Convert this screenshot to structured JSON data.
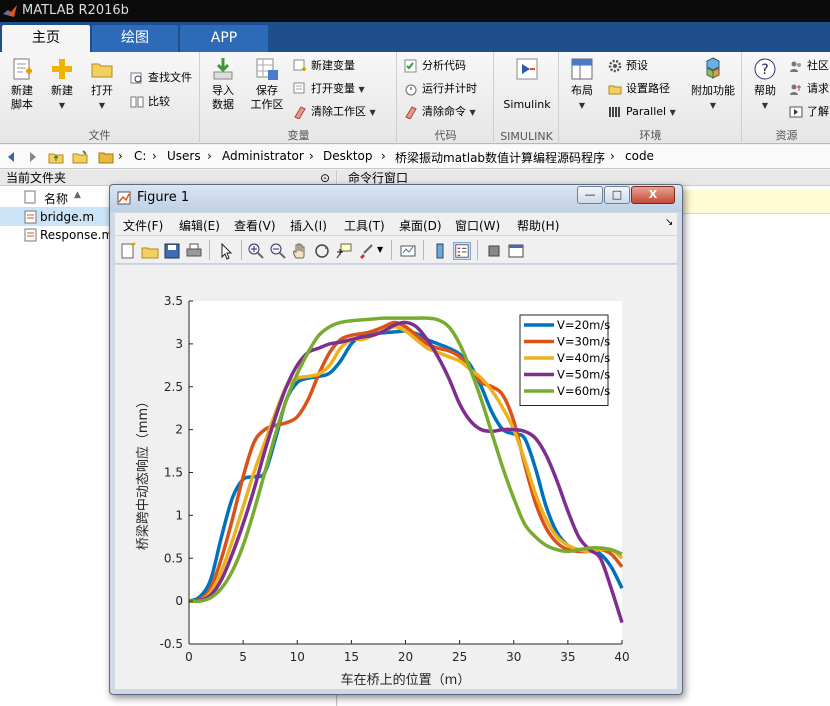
{
  "app": {
    "title": "MATLAB R2016b"
  },
  "ribbon_tabs": [
    {
      "label": "主页",
      "active": true
    },
    {
      "label": "绘图",
      "active": false
    },
    {
      "label": "APP",
      "active": false
    }
  ],
  "groups": {
    "file": {
      "label": "文件",
      "new_script": [
        "新建",
        "脚本"
      ],
      "new": "新建",
      "open": "打开",
      "find_files": "查找文件",
      "compare": "比较"
    },
    "variable": {
      "label": "变量",
      "import": [
        "导入",
        "数据"
      ],
      "save_ws": [
        "保存",
        "工作区"
      ],
      "new_var": "新建变量",
      "open_var": "打开变量",
      "clear_ws": "清除工作区"
    },
    "code": {
      "label": "代码",
      "analyze": "分析代码",
      "run_time": "运行并计时",
      "clear_cmd": "清除命令"
    },
    "simulink": {
      "label": "SIMULINK",
      "btn": "Simulink"
    },
    "env": {
      "label": "环境",
      "layout": "布局",
      "prefs": "预设",
      "set_path": "设置路径",
      "parallel": "Parallel",
      "addons": "附加功能"
    },
    "resources": {
      "label": "资源",
      "help": "帮助",
      "community": "社区",
      "request": "请求",
      "learn": "了解"
    }
  },
  "address": {
    "crumbs": [
      "C:",
      "Users",
      "Administrator",
      "Desktop",
      "桥梁振动matlab数值计算编程源码程序",
      "code"
    ]
  },
  "file_panel": {
    "title": "当前文件夹",
    "col_name": "名称",
    "files": [
      {
        "name": "bridge.m",
        "selected": true
      },
      {
        "name": "Response.m",
        "selected": false
      }
    ]
  },
  "cmd_panel": {
    "title": "命令行窗口"
  },
  "figure": {
    "title": "Figure 1",
    "menu": [
      "文件(F)",
      "编辑(E)",
      "查看(V)",
      "插入(I)",
      "工具(T)",
      "桌面(D)",
      "窗口(W)",
      "帮助(H)"
    ],
    "window_buttons": {
      "min": "—",
      "max": "□",
      "close": "X"
    }
  },
  "chart_data": {
    "type": "line",
    "title": "",
    "xlabel": "车在桥上的位置（m）",
    "ylabel": "桥梁跨中动态响应（mm）",
    "xlim": [
      0,
      40
    ],
    "ylim": [
      -0.5,
      3.5
    ],
    "xticks": [
      0,
      5,
      10,
      15,
      20,
      25,
      30,
      35,
      40
    ],
    "yticks": [
      -0.5,
      0,
      0.5,
      1,
      1.5,
      2,
      2.5,
      3,
      3.5
    ],
    "grid": false,
    "legend_position": "top-right",
    "colors": {
      "axes_bg": "#ffffff",
      "canvas_bg": "#f0f0f0"
    },
    "series": [
      {
        "name": "V=20m/s",
        "color": "#0072bd",
        "x": [
          0,
          1,
          2,
          3,
          4,
          5,
          6,
          7,
          8,
          9,
          10,
          11,
          12,
          13,
          14,
          15,
          16,
          17,
          18,
          19,
          20,
          21,
          22,
          23,
          24,
          25,
          26,
          27,
          28,
          29,
          30,
          31,
          32,
          33,
          34,
          35,
          36,
          37,
          38,
          39,
          40
        ],
        "y": [
          0,
          0.05,
          0.25,
          0.75,
          1.2,
          1.42,
          1.45,
          1.5,
          1.9,
          2.35,
          2.55,
          2.6,
          2.62,
          2.66,
          2.8,
          3.0,
          3.1,
          3.12,
          3.13,
          3.14,
          3.15,
          3.12,
          3.05,
          3.0,
          2.95,
          2.88,
          2.75,
          2.5,
          2.2,
          2.0,
          1.95,
          1.9,
          1.55,
          1.1,
          0.8,
          0.65,
          0.6,
          0.6,
          0.55,
          0.4,
          0.15
        ]
      },
      {
        "name": "V=30m/s",
        "color": "#d95319",
        "x": [
          0,
          1,
          2,
          3,
          4,
          5,
          6,
          7,
          8,
          9,
          10,
          11,
          12,
          13,
          14,
          15,
          16,
          17,
          18,
          19,
          20,
          21,
          22,
          23,
          24,
          25,
          26,
          27,
          28,
          29,
          30,
          31,
          32,
          33,
          34,
          35,
          36,
          37,
          38,
          39,
          40
        ],
        "y": [
          0,
          0.02,
          0.15,
          0.5,
          0.95,
          1.45,
          1.85,
          2.0,
          2.05,
          2.08,
          2.15,
          2.35,
          2.65,
          2.9,
          3.05,
          3.1,
          3.12,
          3.15,
          3.2,
          3.25,
          3.2,
          3.1,
          3.0,
          2.95,
          2.92,
          2.85,
          2.7,
          2.55,
          2.5,
          2.4,
          2.1,
          1.6,
          1.15,
          0.85,
          0.68,
          0.6,
          0.58,
          0.58,
          0.6,
          0.55,
          0.4
        ]
      },
      {
        "name": "V=40m/s",
        "color": "#edb120",
        "x": [
          0,
          1,
          2,
          3,
          4,
          5,
          6,
          7,
          8,
          9,
          10,
          11,
          12,
          13,
          14,
          15,
          16,
          17,
          18,
          19,
          20,
          21,
          22,
          23,
          24,
          25,
          26,
          27,
          28,
          29,
          30,
          31,
          32,
          33,
          34,
          35,
          36,
          37,
          38,
          39,
          40
        ],
        "y": [
          0,
          0.01,
          0.1,
          0.35,
          0.7,
          1.1,
          1.5,
          1.85,
          2.2,
          2.5,
          2.6,
          2.62,
          2.65,
          2.75,
          2.95,
          3.05,
          3.05,
          3.1,
          3.15,
          3.2,
          3.15,
          3.05,
          2.95,
          2.9,
          2.85,
          2.8,
          2.7,
          2.6,
          2.45,
          2.25,
          2.0,
          1.65,
          1.25,
          0.95,
          0.75,
          0.65,
          0.6,
          0.58,
          0.6,
          0.6,
          0.5
        ]
      },
      {
        "name": "V=50m/s",
        "color": "#7e2f8e",
        "x": [
          0,
          1,
          2,
          3,
          4,
          5,
          6,
          7,
          8,
          9,
          10,
          11,
          12,
          13,
          14,
          15,
          16,
          17,
          18,
          19,
          20,
          21,
          22,
          23,
          24,
          25,
          26,
          27,
          28,
          29,
          30,
          31,
          32,
          33,
          34,
          35,
          36,
          37,
          38,
          39,
          40
        ],
        "y": [
          0,
          0.01,
          0.07,
          0.25,
          0.55,
          0.9,
          1.3,
          1.75,
          2.15,
          2.5,
          2.75,
          2.9,
          2.95,
          3.0,
          3.02,
          3.05,
          3.08,
          3.1,
          3.15,
          3.22,
          3.25,
          3.2,
          3.05,
          2.85,
          2.6,
          2.3,
          2.1,
          2.0,
          1.98,
          2.0,
          2.0,
          1.98,
          1.9,
          1.7,
          1.4,
          1.05,
          0.75,
          0.6,
          0.5,
          0.15,
          -0.25
        ]
      },
      {
        "name": "V=60m/s",
        "color": "#77ac30",
        "x": [
          0,
          1,
          2,
          3,
          4,
          5,
          6,
          7,
          8,
          9,
          10,
          11,
          12,
          13,
          14,
          15,
          16,
          17,
          18,
          19,
          20,
          21,
          22,
          23,
          24,
          25,
          26,
          27,
          28,
          29,
          30,
          31,
          32,
          33,
          34,
          35,
          36,
          37,
          38,
          39,
          40
        ],
        "y": [
          0,
          0.0,
          0.04,
          0.15,
          0.35,
          0.65,
          1.05,
          1.5,
          1.95,
          2.35,
          2.65,
          2.9,
          3.1,
          3.2,
          3.25,
          3.27,
          3.28,
          3.29,
          3.3,
          3.3,
          3.3,
          3.3,
          3.3,
          3.28,
          3.2,
          3.0,
          2.7,
          2.35,
          1.95,
          1.55,
          1.2,
          0.9,
          0.75,
          0.65,
          0.6,
          0.58,
          0.6,
          0.62,
          0.62,
          0.6,
          0.55
        ]
      }
    ]
  }
}
